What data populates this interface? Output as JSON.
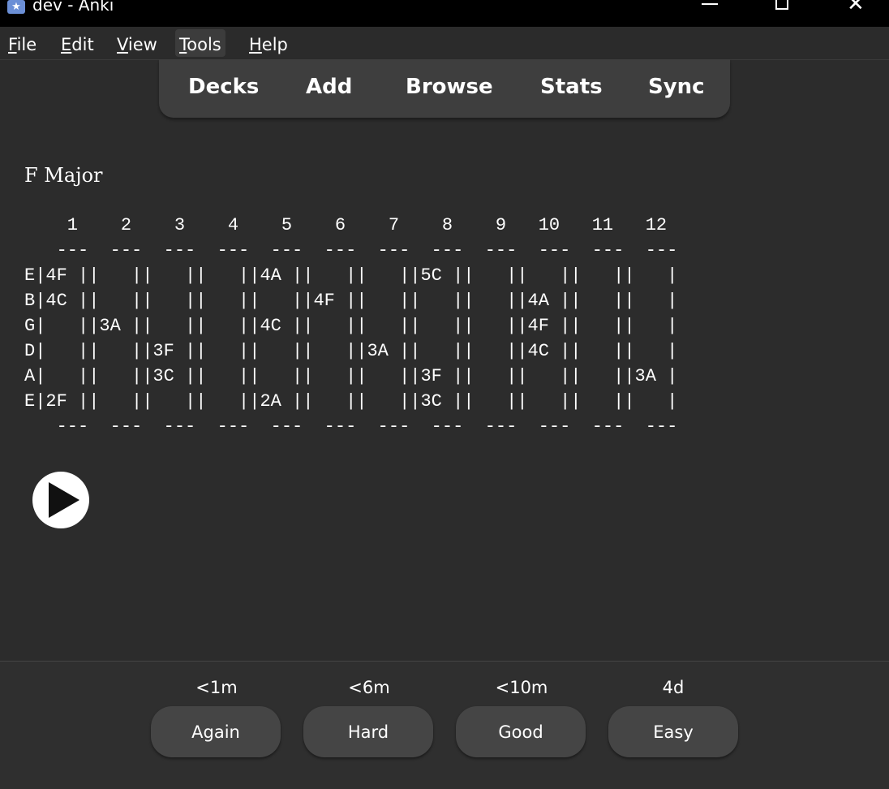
{
  "window": {
    "title": "dev - Anki",
    "app_icon": "anki-star-icon",
    "min_icon": "minimize-icon",
    "max_icon": "maximize-icon",
    "close_icon": "close-icon",
    "close_glyph": "✕"
  },
  "menu": {
    "file": {
      "mnemonic": "F",
      "rest": "ile"
    },
    "edit": {
      "mnemonic": "E",
      "rest": "dit"
    },
    "view": {
      "mnemonic": "V",
      "rest": "iew"
    },
    "tools": {
      "mnemonic": "T",
      "rest": "ools"
    },
    "help": {
      "mnemonic": "H",
      "rest": "elp"
    }
  },
  "toolbar": {
    "decks": "Decks",
    "add": "Add",
    "browse": "Browse",
    "stats": "Stats",
    "sync": "Sync"
  },
  "card": {
    "title": "F Major",
    "tab_lines": [
      "    1    2    3    4    5    6    7    8    9   10   11   12",
      "   ---  ---  ---  ---  ---  ---  ---  ---  ---  ---  ---  ---",
      "E|4F ||   ||   ||   ||4A ||   ||   ||5C ||   ||   ||   ||   |",
      "B|4C ||   ||   ||   ||   ||4F ||   ||   ||   ||4A ||   ||   |",
      "G|   ||3A ||   ||   ||4C ||   ||   ||   ||   ||4F ||   ||   |",
      "D|   ||   ||3F ||   ||   ||   ||3A ||   ||   ||4C ||   ||   |",
      "A|   ||   ||3C ||   ||   ||   ||   ||3F ||   ||   ||   ||3A |",
      "E|2F ||   ||   ||   ||2A ||   ||   ||3C ||   ||   ||   ||   |",
      "   ---  ---  ---  ---  ---  ---  ---  ---  ---  ---  ---  ---"
    ],
    "play_icon": "play-icon"
  },
  "answer_buttons": [
    {
      "interval": "<1m",
      "label": "Again"
    },
    {
      "interval": "<6m",
      "label": "Hard"
    },
    {
      "interval": "<10m",
      "label": "Good"
    },
    {
      "interval": "4d",
      "label": "Easy"
    }
  ]
}
